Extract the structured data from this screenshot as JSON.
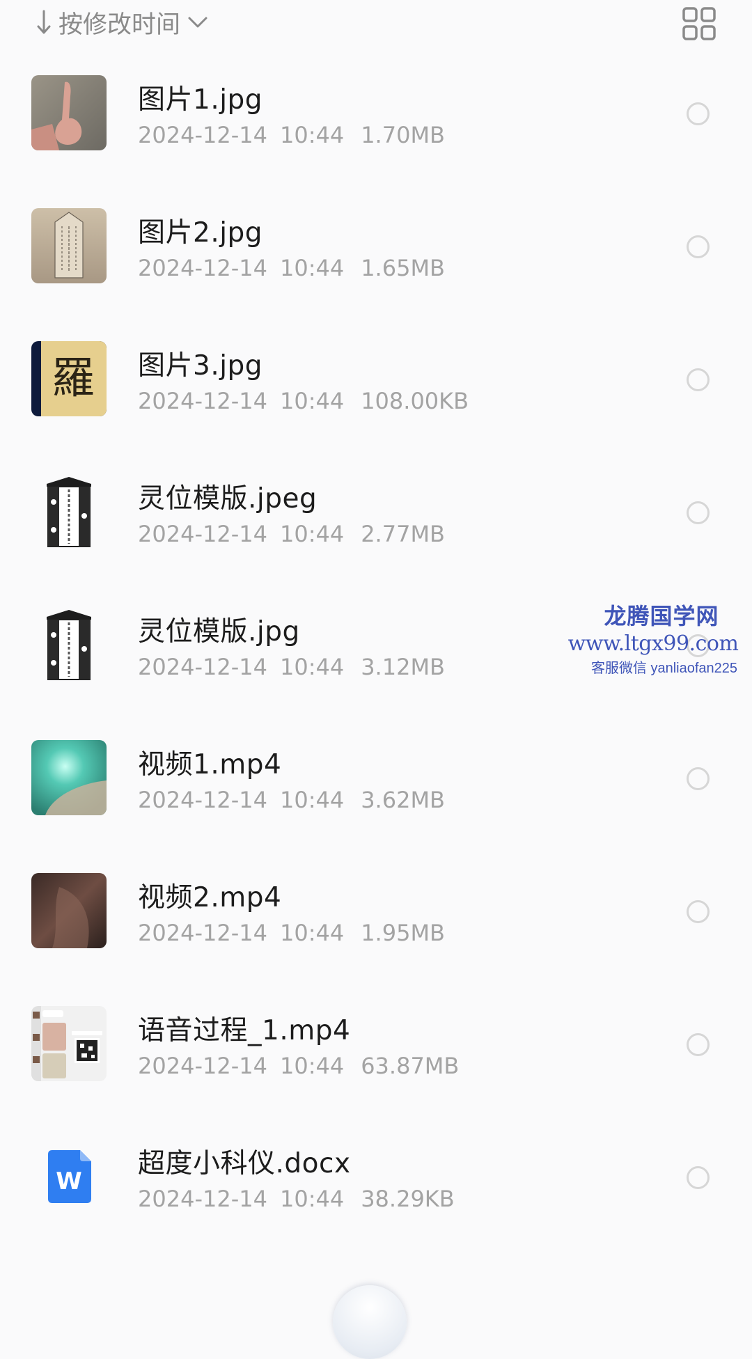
{
  "sort_bar": {
    "label": "按修改时间",
    "direction_icon": "arrow-down-icon",
    "expand_icon": "chevron-down-icon",
    "view_icon": "grid-view-icon"
  },
  "files": [
    {
      "name": "图片1.jpg",
      "date": "2024-12-14",
      "time": "10:44",
      "size": "1.70MB",
      "thumb": "photo-hand"
    },
    {
      "name": "图片2.jpg",
      "date": "2024-12-14",
      "time": "10:44",
      "size": "1.65MB",
      "thumb": "photo-paper"
    },
    {
      "name": "图片3.jpg",
      "date": "2024-12-14",
      "time": "10:44",
      "size": "108.00KB",
      "thumb": "photo-calligraphy",
      "thumb_text": "羅"
    },
    {
      "name": "灵位模版.jpeg",
      "date": "2024-12-14",
      "time": "10:44",
      "size": "2.77MB",
      "thumb": "template-tablet"
    },
    {
      "name": "灵位模版.jpg",
      "date": "2024-12-14",
      "time": "10:44",
      "size": "3.12MB",
      "thumb": "template-tablet"
    },
    {
      "name": "视频1.mp4",
      "date": "2024-12-14",
      "time": "10:44",
      "size": "3.62MB",
      "thumb": "video-teal"
    },
    {
      "name": "视频2.mp4",
      "date": "2024-12-14",
      "time": "10:44",
      "size": "1.95MB",
      "thumb": "video-dark"
    },
    {
      "name": "语音过程_1.mp4",
      "date": "2024-12-14",
      "time": "10:44",
      "size": "63.87MB",
      "thumb": "video-chat"
    },
    {
      "name": "超度小科仪.docx",
      "date": "2024-12-14",
      "time": "10:44",
      "size": "38.29KB",
      "thumb": "word-doc-icon",
      "thumb_text": "W"
    }
  ],
  "watermark": {
    "title": "龙腾国学网",
    "url": "www.ltgx99.com",
    "contact": "客服微信 yanliaofan225"
  },
  "colors": {
    "background": "#fafafb",
    "name_text": "#1c1c1c",
    "meta_text": "#a3a3a3",
    "sort_text": "#8a8a8a",
    "radio_border": "#d6d6d6",
    "word_blue": "#2f7ef1",
    "watermark": "#3f55b8"
  }
}
